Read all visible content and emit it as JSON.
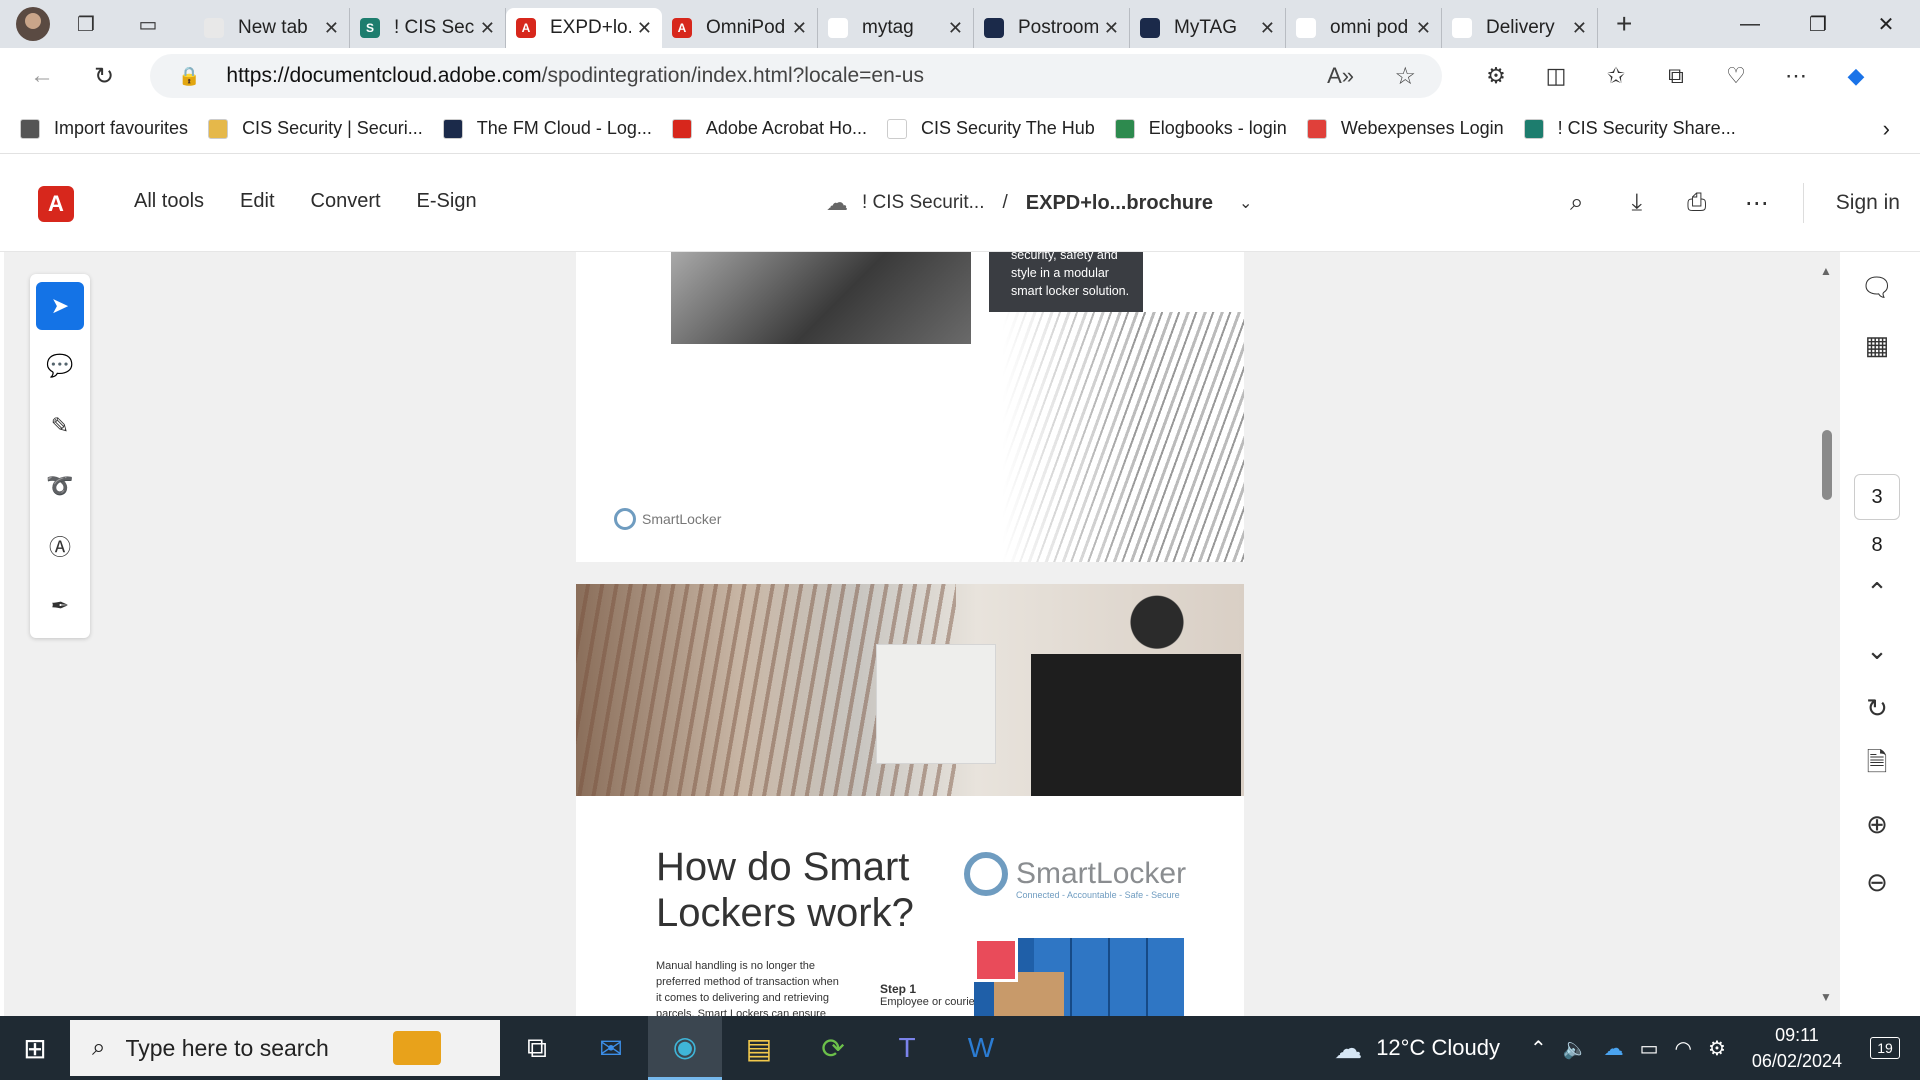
{
  "browser": {
    "tabs": [
      {
        "title": "New tab",
        "fav_color": "#e8e8e8",
        "fav_glyph": ""
      },
      {
        "title": "! CIS Security",
        "fav_color": "#1d7d6e",
        "fav_glyph": "S"
      },
      {
        "title": "EXPD+lo...brochure",
        "fav_color": "#d7271c",
        "fav_glyph": "A",
        "active": true
      },
      {
        "title": "OmniPod",
        "fav_color": "#d7271c",
        "fav_glyph": "A"
      },
      {
        "title": "mytag",
        "fav_color": "#ffffff",
        "fav_glyph": ""
      },
      {
        "title": "Postroom",
        "fav_color": "#1b2a4a",
        "fav_glyph": ""
      },
      {
        "title": "MyTAG",
        "fav_color": "#1b2a4a",
        "fav_glyph": ""
      },
      {
        "title": "omni pod",
        "fav_color": "#ffffff",
        "fav_glyph": ""
      },
      {
        "title": "Delivery",
        "fav_color": "#ffffff",
        "fav_glyph": ""
      }
    ],
    "url_host": "https://documentcloud.adobe.com",
    "url_path": "/spodintegration/index.html?locale=en-us",
    "bookmarks": [
      {
        "label": "Import favourites",
        "color": "#555"
      },
      {
        "label": "CIS Security | Securi...",
        "color": "#e5b84a"
      },
      {
        "label": "The FM Cloud - Log...",
        "color": "#1b2a4a"
      },
      {
        "label": "Adobe Acrobat Ho...",
        "color": "#d7271c"
      },
      {
        "label": "CIS Security The Hub",
        "color": "#ffffff"
      },
      {
        "label": "Elogbooks - login",
        "color": "#2d8a4e"
      },
      {
        "label": "Webexpenses Login",
        "color": "#e0403a"
      },
      {
        "label": "! CIS Security Share...",
        "color": "#1d7d6e"
      }
    ]
  },
  "acrobat": {
    "menu": [
      "All tools",
      "Edit",
      "Convert",
      "E-Sign"
    ],
    "folder": "! CIS Securit...",
    "file": "EXPD+lo...brochure",
    "sign_in": "Sign in",
    "current_page": "3",
    "total_pages": "8"
  },
  "doc": {
    "callout_text": "security, safety and style in a modular smart locker solution.",
    "small_logo": "SmartLocker",
    "heading": "How do Smart Lockers work?",
    "logo_name": "SmartLocker",
    "logo_tagline": "Connected - Accountable - Safe - Secure",
    "body": "Manual handling is no longer the preferred method of transaction when it comes to delivering and retrieving parcels, Smart Lockers can ensure",
    "step_title": "Step 1",
    "step_text": "Employee or courier"
  },
  "taskbar": {
    "search_placeholder": "Type here to search",
    "weather": "12°C  Cloudy",
    "time": "09:11",
    "date": "06/02/2024",
    "notifications": "19"
  }
}
